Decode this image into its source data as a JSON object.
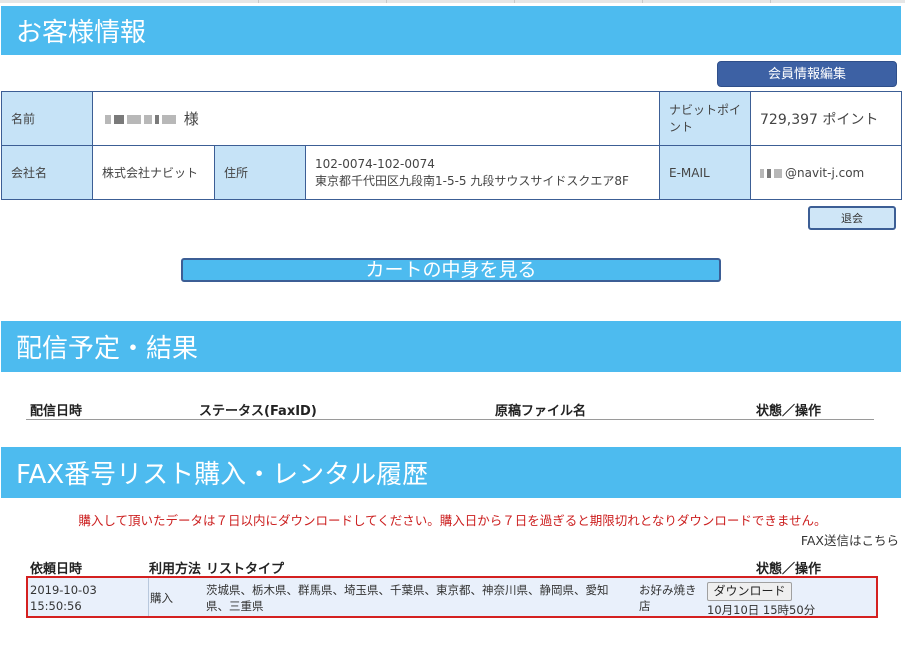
{
  "customer_section": {
    "title": "お客様情報",
    "member_edit_button": "会員情報編集",
    "name_label": "名前",
    "name_suffix": "様",
    "points_label": "ナビットポイント",
    "points_value": "729,397 ポイント",
    "company_label": "会社名",
    "company_value": "株式会社ナビット",
    "address_label": "住所",
    "address_line1": "102-0074-102-0074",
    "address_line2": "東京都千代田区九段南1-5-5 九段サウスサイドスクエア8F",
    "email_label": "E-MAIL",
    "email_value": "@navit-j.com",
    "withdraw_button": "退会",
    "cart_button": "カートの中身を見る"
  },
  "delivery_section": {
    "title": "配信予定・結果",
    "columns": [
      "配信日時",
      "ステータス(FaxID)",
      "原稿ファイル名",
      "状態／操作"
    ]
  },
  "history_section": {
    "title": "FAX番号リスト購入・レンタル履歴",
    "notice": "購入して頂いたデータは７日以内にダウンロードしてください。購入日から７日を過ぎると期限切れとなりダウンロードできません。",
    "fax_link": "FAX送信はこちら",
    "columns": [
      "依頼日時",
      "利用方法",
      "リストタイプ",
      "状態／操作"
    ],
    "rows": [
      {
        "date": "2019-10-03",
        "time": "15:50:56",
        "method": "購入",
        "regions_line1": "茨城県、栃木県、群馬県、埼玉県、千葉県、東京都、神奈川県、静岡県、愛知",
        "regions_line2": "県、三重県",
        "list_type_line1": "お好み焼き",
        "list_type_line2": "店",
        "download_button": "ダウンロード",
        "expiry": "10月10日 15時50分"
      }
    ]
  }
}
